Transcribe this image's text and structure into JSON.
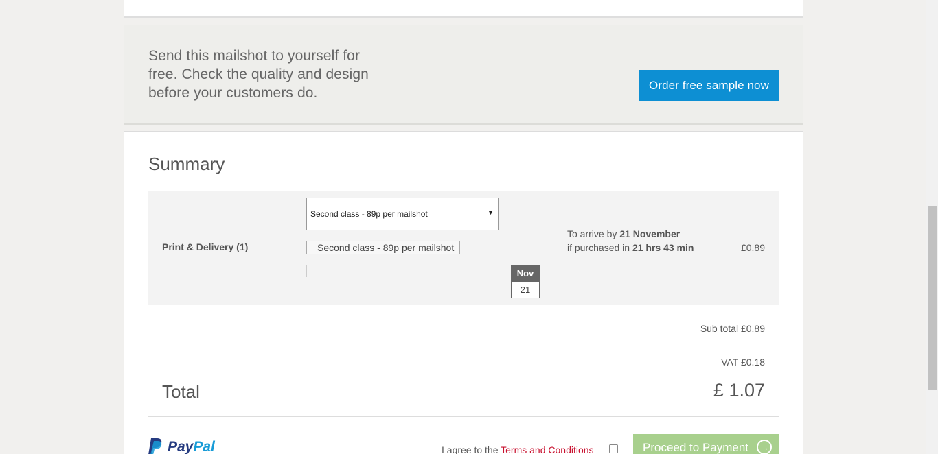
{
  "sample": {
    "text": "Send this mailshot to yourself for free. Check the quality and design before your customers do.",
    "button_label": "Order free sample now"
  },
  "summary": {
    "title": "Summary",
    "delivery": {
      "label": "Print & Delivery (1)",
      "selected_option": "Second class - 89p per mailshot",
      "option_text": "Second class - 89p per mailshot",
      "calendar_month": "Nov",
      "calendar_day": "21",
      "arrive_prefix": "To arrive by ",
      "arrive_date": "21 November",
      "purchase_prefix": "if purchased in ",
      "purchase_time": "21 hrs 43 min",
      "price": "£0.89"
    },
    "subtotal": "Sub total £0.89",
    "vat": "VAT £0.18",
    "total_label": "Total",
    "total_value": "£ 1.07"
  },
  "checkout": {
    "paypal_pay": "Pay",
    "paypal_pal": "Pal",
    "terms_prefix": "I agree to the ",
    "terms_link": "Terms and Conditions",
    "proceed_label": "Proceed to Payment",
    "proceed_icon": "arrow-right-circle-icon"
  },
  "colors": {
    "accent_blue": "#0d8fd3",
    "proceed_green": "#a8d08d",
    "link_red": "#c8102e",
    "paypal_dark": "#253b80",
    "paypal_light": "#179bd7"
  }
}
